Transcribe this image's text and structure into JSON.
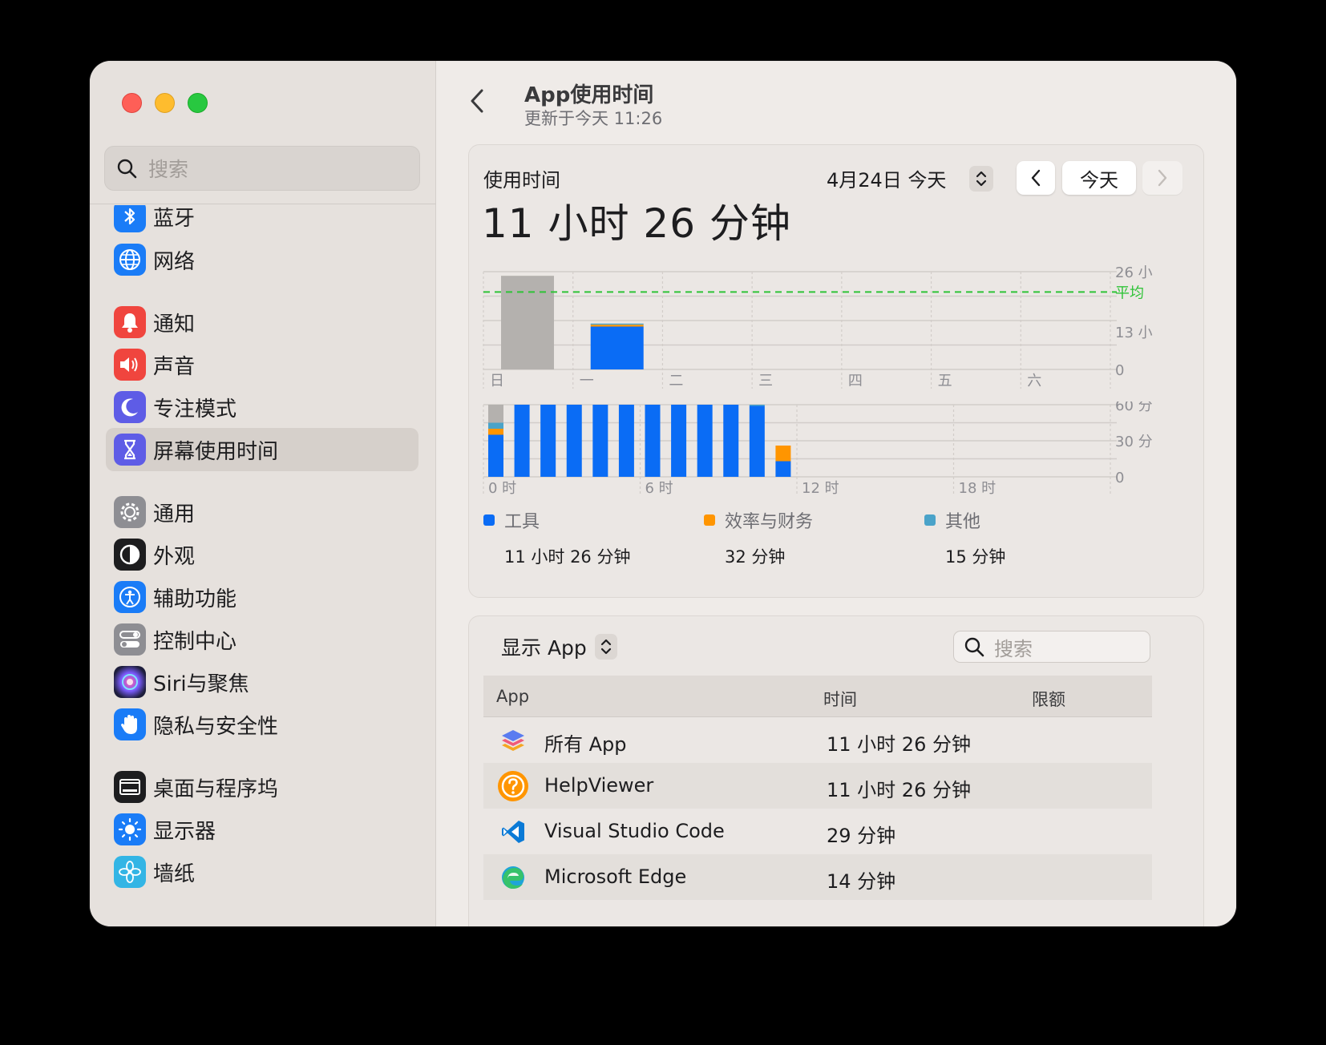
{
  "sidebar": {
    "search_placeholder": "搜索",
    "items": [
      {
        "label": "蓝牙",
        "icon": "bluetooth-icon",
        "color": "#1a7cf7"
      },
      {
        "label": "网络",
        "icon": "globe-icon",
        "color": "#1a7cf7"
      },
      {
        "label": "通知",
        "icon": "bell-icon",
        "color": "#f0453e"
      },
      {
        "label": "声音",
        "icon": "speaker-icon",
        "color": "#f0453e"
      },
      {
        "label": "专注模式",
        "icon": "moon-icon",
        "color": "#5e5ce6"
      },
      {
        "label": "屏幕使用时间",
        "icon": "hourglass-icon",
        "color": "#5e5ce6"
      },
      {
        "label": "通用",
        "icon": "gear-icon",
        "color": "#8e8e93"
      },
      {
        "label": "外观",
        "icon": "appearance-icon",
        "color": "#1d1d1f"
      },
      {
        "label": "辅助功能",
        "icon": "accessibility-icon",
        "color": "#1a7cf7"
      },
      {
        "label": "控制中心",
        "icon": "toggles-icon",
        "color": "#8e8e93"
      },
      {
        "label": "Siri与聚焦",
        "icon": "siri-icon",
        "color": "#2b2b52"
      },
      {
        "label": "隐私与安全性",
        "icon": "hand-icon",
        "color": "#1a7cf7"
      },
      {
        "label": "桌面与程序坞",
        "icon": "dock-icon",
        "color": "#1d1d1f"
      },
      {
        "label": "显示器",
        "icon": "sun-icon",
        "color": "#1a7cf7"
      },
      {
        "label": "墙纸",
        "icon": "flower-icon",
        "color": "#33b5e5"
      }
    ]
  },
  "header": {
    "title": "App使用时间",
    "subtitle": "更新于今天 11:26"
  },
  "usage": {
    "label": "使用时间",
    "total": "11 小时 26 分钟",
    "date": "4月24日 今天",
    "today_button": "今天"
  },
  "legend": [
    {
      "name": "工具",
      "value": "11 小时 26 分钟",
      "color": "#0a6cf5"
    },
    {
      "name": "效率与财务",
      "value": "32 分钟",
      "color": "#ff9500"
    },
    {
      "name": "其他",
      "value": "15 分钟",
      "color": "#4aa3c9"
    }
  ],
  "chart_data": [
    {
      "type": "bar",
      "categories": [
        "日",
        "一",
        "二",
        "三",
        "四",
        "五",
        "六"
      ],
      "y_tick_labels": [
        "26 小",
        "13 小",
        "0"
      ],
      "ylim": [
        0,
        26
      ],
      "average_label": "平均",
      "average": 20.6,
      "series": [
        {
          "values": [
            24.9,
            0,
            0,
            0,
            0,
            0,
            0
          ],
          "color": "#b4b1ae"
        },
        {
          "values": [
            0,
            11.4,
            0,
            0,
            0,
            0,
            0
          ],
          "color": "#0a6cf5"
        },
        {
          "values": [
            0,
            0.5,
            0,
            0,
            0,
            0,
            0
          ],
          "color": "#ff9500"
        },
        {
          "values": [
            0,
            0.3,
            0,
            0,
            0,
            0,
            0
          ],
          "color": "#4aa3c9"
        }
      ],
      "colors": {
        "average_line": "#2fc337"
      }
    },
    {
      "type": "bar",
      "x_tick_labels": [
        "0 时",
        "6 时",
        "12 时",
        "18 时"
      ],
      "y_tick_labels": [
        "60 分",
        "30 分",
        "0"
      ],
      "ylim": [
        0,
        60
      ],
      "hours": [
        0,
        1,
        2,
        3,
        4,
        5,
        6,
        7,
        8,
        9,
        10,
        11
      ],
      "series": [
        {
          "values": [
            35,
            60,
            60,
            60,
            60,
            60,
            60,
            60,
            60,
            60,
            59,
            13
          ],
          "color": "#0a6cf5"
        },
        {
          "values": [
            5,
            0,
            0,
            0,
            0,
            0,
            0,
            0,
            0,
            0,
            0,
            13
          ],
          "color": "#ff9500"
        },
        {
          "values": [
            5,
            0,
            0,
            0,
            0,
            0,
            0,
            0,
            0,
            0,
            1,
            0
          ],
          "color": "#4aa3c9"
        },
        {
          "values": [
            15,
            0,
            0,
            0,
            0,
            0,
            0,
            0,
            0,
            0,
            0,
            0
          ],
          "color": "#b4b1ae"
        }
      ]
    }
  ],
  "apps": {
    "show_label": "显示 App",
    "search_placeholder": "搜索",
    "columns": [
      "App",
      "时间",
      "限额"
    ],
    "rows": [
      {
        "name": "所有 App",
        "time": "11 小时 26 分钟",
        "icon": "layers-icon"
      },
      {
        "name": "HelpViewer",
        "time": "11 小时 26 分钟",
        "icon": "help-icon"
      },
      {
        "name": "Visual Studio Code",
        "time": "29 分钟",
        "icon": "vscode-icon"
      },
      {
        "name": "Microsoft Edge",
        "time": "14 分钟",
        "icon": "edge-icon"
      }
    ]
  }
}
